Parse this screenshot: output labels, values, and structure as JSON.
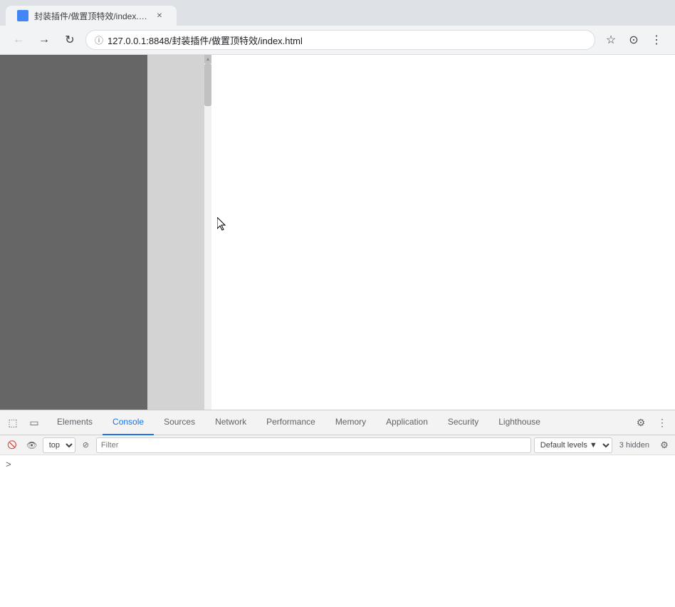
{
  "browser": {
    "tab_title": "封装插件/做置顶特效/index.html",
    "url": "127.0.0.1:8848/封装插件/做置顶特效/index.html",
    "nav": {
      "back_label": "←",
      "forward_label": "→",
      "reload_label": "↻"
    }
  },
  "devtools": {
    "tabs": [
      {
        "label": "Elements",
        "active": false
      },
      {
        "label": "Console",
        "active": true
      },
      {
        "label": "Sources",
        "active": false
      },
      {
        "label": "Network",
        "active": false
      },
      {
        "label": "Performance",
        "active": false
      },
      {
        "label": "Memory",
        "active": false
      },
      {
        "label": "Application",
        "active": false
      },
      {
        "label": "Security",
        "active": false
      },
      {
        "label": "Lighthouse",
        "active": false
      }
    ],
    "toolbar": {
      "context_options": [
        "top"
      ],
      "context_value": "top",
      "filter_placeholder": "Filter",
      "levels_label": "Default levels ▼",
      "hidden_count": "3 hidden"
    }
  }
}
